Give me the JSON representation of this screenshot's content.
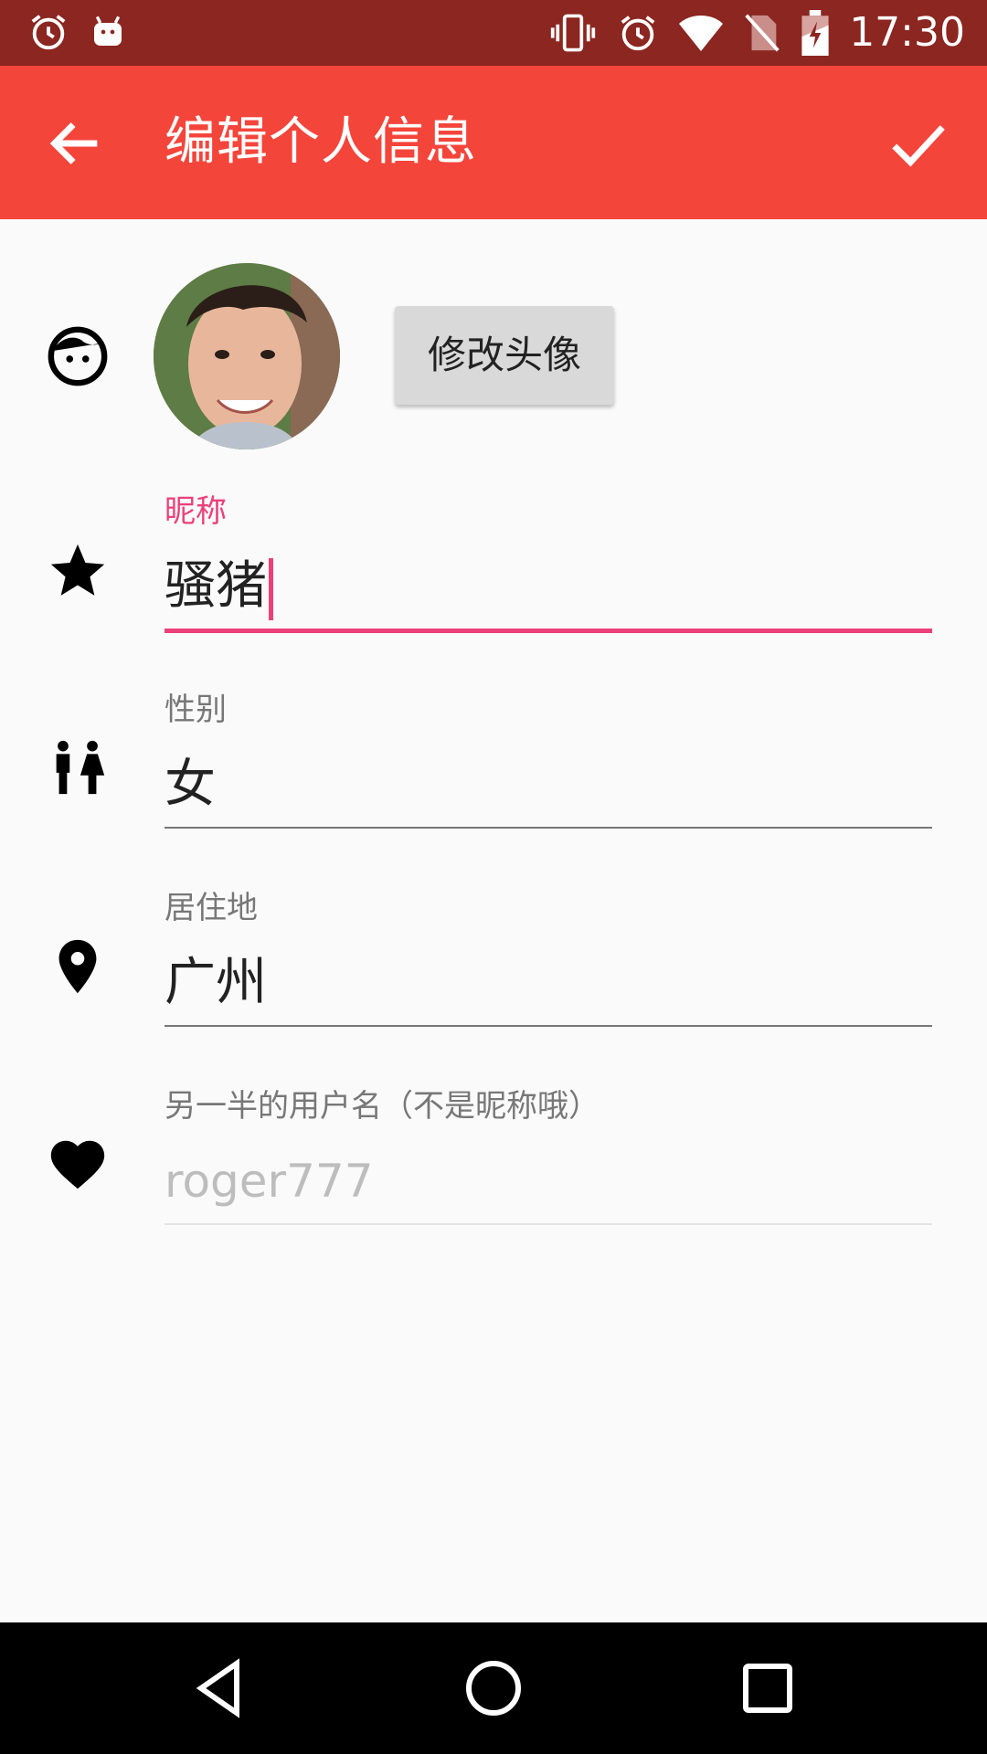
{
  "status_bar": {
    "time": "17:30",
    "icons": [
      "alarm-icon",
      "android-icon",
      "vibrate-icon",
      "alarm-icon",
      "wifi-icon",
      "no-sim-icon",
      "battery-charging-icon"
    ]
  },
  "toolbar": {
    "title": "编辑个人信息",
    "back_icon": "arrow-back-icon",
    "confirm_icon": "check-icon"
  },
  "avatar_row": {
    "icon": "face-icon",
    "change_button_label": "修改头像"
  },
  "fields": {
    "nickname": {
      "label": "昵称",
      "value": "骚猪",
      "icon": "star-icon"
    },
    "gender": {
      "label": "性别",
      "value": "女",
      "icon": "wc-icon"
    },
    "residence": {
      "label": "居住地",
      "value": "广州",
      "icon": "location-pin-icon"
    },
    "partner": {
      "label": "另一半的用户名（不是昵称哦）",
      "placeholder": "roger777",
      "icon": "heart-icon"
    }
  },
  "colors": {
    "status_bar": "#8b2620",
    "toolbar": "#f4453b",
    "accent": "#ec407a",
    "background": "#fafafa",
    "nav_bar": "#000000"
  },
  "nav_bar": {
    "buttons": [
      "back-triangle-icon",
      "home-circle-icon",
      "recents-square-icon"
    ]
  }
}
